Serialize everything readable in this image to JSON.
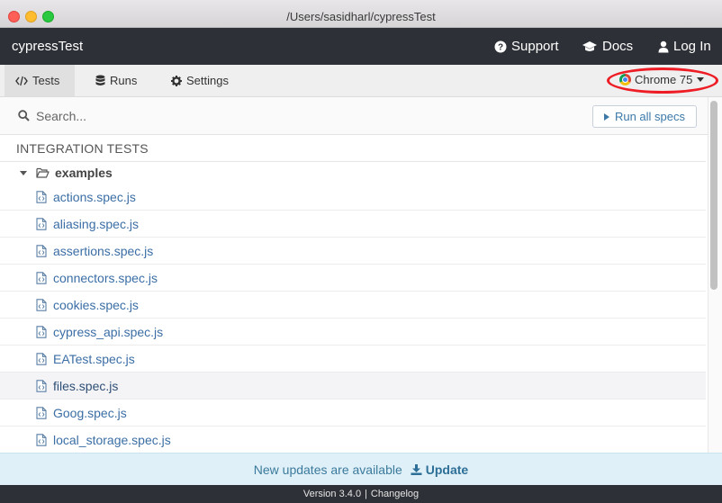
{
  "window": {
    "title": "/Users/sasidharl/cypressTest"
  },
  "topnav": {
    "project_name": "cypressTest",
    "support_label": "Support",
    "docs_label": "Docs",
    "login_label": "Log In"
  },
  "tabs": {
    "tests_label": "Tests",
    "runs_label": "Runs",
    "settings_label": "Settings",
    "active": "Tests"
  },
  "browser": {
    "label": "Chrome 75",
    "icon": "chrome-icon"
  },
  "search": {
    "placeholder": "Search...",
    "value": ""
  },
  "run_all": {
    "label": "Run all specs"
  },
  "specs": {
    "section_title": "INTEGRATION TESTS",
    "folder": "examples",
    "files": [
      "actions.spec.js",
      "aliasing.spec.js",
      "assertions.spec.js",
      "connectors.spec.js",
      "cookies.spec.js",
      "cypress_api.spec.js",
      "EATest.spec.js",
      "files.spec.js",
      "Goog.spec.js",
      "local_storage.spec.js"
    ],
    "hovered": "files.spec.js"
  },
  "update": {
    "message": "New updates are available",
    "link_label": "Update"
  },
  "footer": {
    "version": "Version 3.4.0",
    "separator": "|",
    "changelog": "Changelog"
  },
  "colors": {
    "nav_bg": "#2d3036",
    "link": "#3b6ea5",
    "update_bg": "#dff0f8",
    "highlight": "#ee1c24"
  }
}
